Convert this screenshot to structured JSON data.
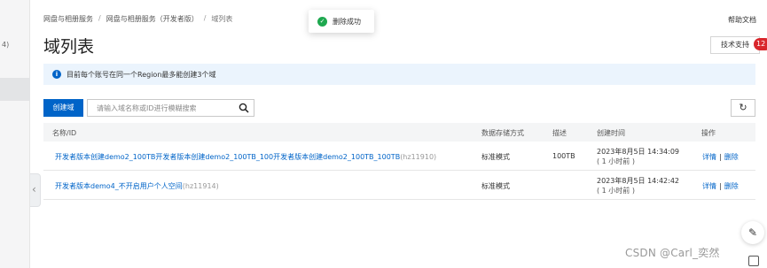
{
  "sidebar": {
    "fragment": "4)"
  },
  "breadcrumb": {
    "items": [
      "网盘与相册服务",
      "网盘与相册服务（开发者版）",
      "域列表"
    ],
    "separator": "/"
  },
  "toast": {
    "message": "删除成功"
  },
  "header": {
    "help_link": "帮助文档",
    "title": "域列表"
  },
  "support": {
    "label": "技术支持",
    "badge": "12"
  },
  "notice": {
    "text": "目前每个账号在同一个Region最多能创建3个域"
  },
  "toolbar": {
    "create_label": "创建域",
    "search_placeholder": "请输入域名称或ID进行模糊搜索"
  },
  "table": {
    "headers": {
      "name": "名称/ID",
      "storage": "数据存储方式",
      "desc": "描述",
      "created": "创建时间",
      "ops": "操作"
    },
    "rows": [
      {
        "name": "开发者版本创建demo2_100TB开发者版本创建demo2_100TB_100开发者版本创建demo2_100TB_100TB",
        "id": "(hz11910)",
        "storage": "标准模式",
        "desc": "100TB",
        "created": "2023年8月5日 14:34:09",
        "relative": "( 1 小时前 )",
        "detail": "详情",
        "delete": "删除",
        "bar": "|"
      },
      {
        "name": "开发者版本demo4_不开启用户个人空间",
        "id": "(hz11914)",
        "storage": "标准模式",
        "desc": "",
        "created": "2023年8月5日 14:42:42",
        "relative": "( 1 小时前 )",
        "detail": "详情",
        "delete": "删除",
        "bar": "|"
      }
    ]
  },
  "watermark": "CSDN @Carl_奕然",
  "colors": {
    "primary": "#0064c8",
    "success": "#1ea84f",
    "notice_bg": "#ebf4fd",
    "badge": "#d9262c"
  }
}
